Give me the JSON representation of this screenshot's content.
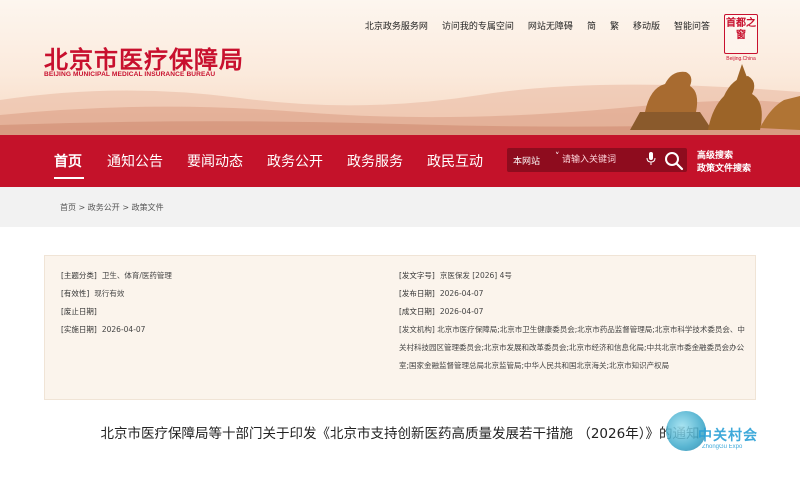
{
  "header": {
    "top_links": [
      "北京政务服务网",
      "访问我的专属空间",
      "网站无障碍",
      "简",
      "繁",
      "移动版",
      "智能问答"
    ],
    "logo_cn": "北京市医疗保障局",
    "logo_en": "BEIJING MUNICIPAL MEDICAL INSURANCE BUREAU",
    "seal_text": "首都之窗",
    "seal_caption": "Beijing.China"
  },
  "nav": {
    "items": [
      "首页",
      "通知公告",
      "要闻动态",
      "政务公开",
      "政务服务",
      "政民互动"
    ],
    "active_index": 0
  },
  "search": {
    "scope": "本网站",
    "placeholder": "请输入关键词",
    "advanced": "高级搜索",
    "policy": "政策文件搜索"
  },
  "breadcrumb": [
    "首页",
    "政务公开",
    "政策文件"
  ],
  "meta": {
    "topic_label": "[主题分类]",
    "topic": "卫生、体育/医药管理",
    "validity_label": "[有效性]",
    "validity": "现行有效",
    "repeal_label": "[废止日期]",
    "effective_label": "[实施日期]",
    "effective": "2026-04-07",
    "docno_label": "[发文字号]",
    "docno": "京医保发 [2026] 4号",
    "publish_label": "[发布日期]",
    "publish": "2026-04-07",
    "written_label": "[成文日期]",
    "written": "2026-04-07",
    "agency_label": "[发文机构]",
    "agency": "北京市医疗保障局;北京市卫生健康委员会;北京市药品监督管理局;北京市科学技术委员会、中关村科技园区管理委员会;北京市发展和改革委员会;北京市经济和信息化局;中共北京市委金融委员会办公室;国家金融监督管理总局北京监管局;中华人民共和国北京海关;北京市知识产权局"
  },
  "doc_title": "北京市医疗保障局等十部门关于印发《北京市支持创新医药高质量发展若干措施 （2026年）》的通知",
  "watermark": {
    "text": "中关村会",
    "sub": "ZhongGu Expo"
  },
  "colors": {
    "brand_red": "#c4122a",
    "search_bg": "#8e0c1e",
    "meta_bg": "#fbf4ec"
  }
}
